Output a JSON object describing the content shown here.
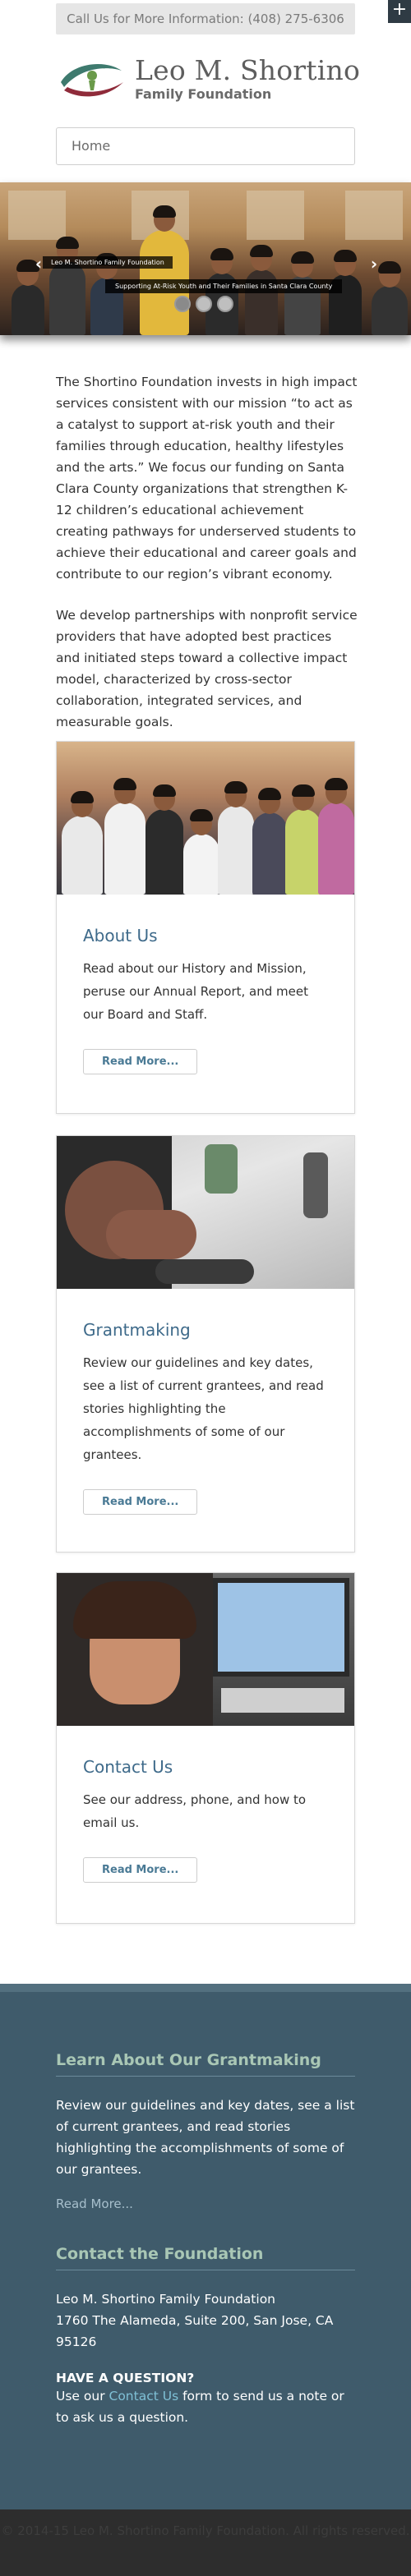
{
  "contact_bar": "Call Us for More Information: (408) 275-6306",
  "logo": {
    "name": "Leo M. Shortino",
    "subtitle": "Family Foundation"
  },
  "nav": {
    "selected": "Home"
  },
  "slider": {
    "caption_left": "Leo M. Shortino Family Foundation",
    "caption_right": "Supporting At-Risk Youth and Their Families in Santa Clara County",
    "prev_label": "‹",
    "next_label": "›"
  },
  "intro": {
    "p1": "The Shortino Foundation invests in high impact services consistent with our mission “to act as a catalyst to support at-risk youth and their families through education, healthy lifestyles and the arts.” We focus our funding on Santa Clara County organizations that strengthen K-12 children’s educational achievement creating pathways for underserved students to achieve their educational and career goals and contribute to our region’s vibrant economy.",
    "p2": "We develop partnerships with nonprofit service providers that have adopted best practices and initiated steps toward a collective impact model, characterized by cross-sector collaboration, integrated services, and measurable goals."
  },
  "cards": [
    {
      "title": "About Us",
      "text": "Read about our History and Mission, peruse our Annual Report, and meet our Board and Staff.",
      "button": "Read More..."
    },
    {
      "title": "Grantmaking",
      "text": "Review our guidelines and key dates, see a list of current grantees, and read stories highlighting the accomplishments of some of our grantees.",
      "button": "Read More..."
    },
    {
      "title": "Contact Us",
      "text": "See our address, phone, and how to email us.",
      "button": "Read More..."
    }
  ],
  "footer": {
    "grant_title": "Learn About Our Grantmaking",
    "grant_text": "Review our guidelines and key dates, see a list of current grantees, and read stories highlighting the accomplishments of some of our grantees.",
    "grant_link": "Read More...",
    "contact_title": "Contact the Foundation",
    "org_name": "Leo M. Shortino Family Foundation",
    "address": "1760 The Alameda, Suite 200, San Jose, CA 95126",
    "question_heading": "HAVE A QUESTION?",
    "question_pre": "Use our ",
    "question_link": "Contact Us",
    "question_post": " form to send us a note or to ask us a question."
  },
  "copyright": "© 2014-15 Leo M. Shortino Family Foundation. All rights reserved.",
  "colors": {
    "accent": "#3e6a8a",
    "footer_bg": "#3f5b6b",
    "footer_heading": "#a9c7b5",
    "link": "#7fc0d6"
  }
}
